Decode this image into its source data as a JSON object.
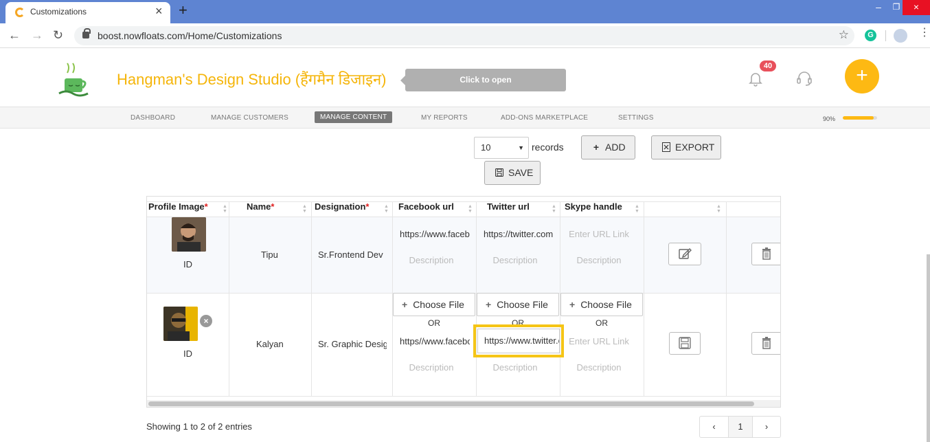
{
  "browser": {
    "tab_title": "Customizations",
    "url": "boost.nowfloats.com/Home/Customizations",
    "extension_letter": "G"
  },
  "header": {
    "brand": "Hangman's Design Studio (हैंगमैन डिजाइन)",
    "tooltip": "Click to open http://www.brajmadhav.com",
    "notification_count": "40",
    "fab_label": "+"
  },
  "nav": {
    "items": [
      "DASHBOARD",
      "MANAGE CUSTOMERS",
      "MANAGE CONTENT",
      "MY REPORTS",
      "ADD-ONS MARKETPLACE",
      "SETTINGS"
    ],
    "active": "MANAGE CONTENT",
    "progress_label": "90%",
    "progress": 0.9,
    "accent": "#fdb913"
  },
  "controls": {
    "records_value": "10",
    "records_label": "records",
    "add_label": "ADD",
    "export_label": "EXPORT",
    "save_label": "SAVE"
  },
  "table": {
    "headers": [
      "Profile Image",
      "Name",
      "Designation",
      "Facebook url",
      "Twitter url",
      "Skype handle"
    ],
    "required_marker": "*",
    "rows": [
      {
        "id_label": "ID",
        "name": "Tipu",
        "designation": "Sr.Frontend Dev",
        "facebook": "https://www.facebook.com",
        "twitter": "https://twitter.com",
        "skype_placeholder": "Enter URL Link",
        "description_placeholder": "Description"
      },
      {
        "id_label": "ID",
        "name": "Kalyan",
        "designation": "Sr. Graphic Designer",
        "choose_file": "Choose File",
        "or": "OR",
        "facebook": "https//www.facebook.com",
        "twitter": "https://www.twitter.com",
        "skype_placeholder": "Enter URL Link",
        "description_placeholder": "Description"
      }
    ]
  },
  "footer": {
    "showing": "Showing 1 to 2 of 2 entries",
    "prev": "‹",
    "page": "1",
    "next": "›"
  }
}
